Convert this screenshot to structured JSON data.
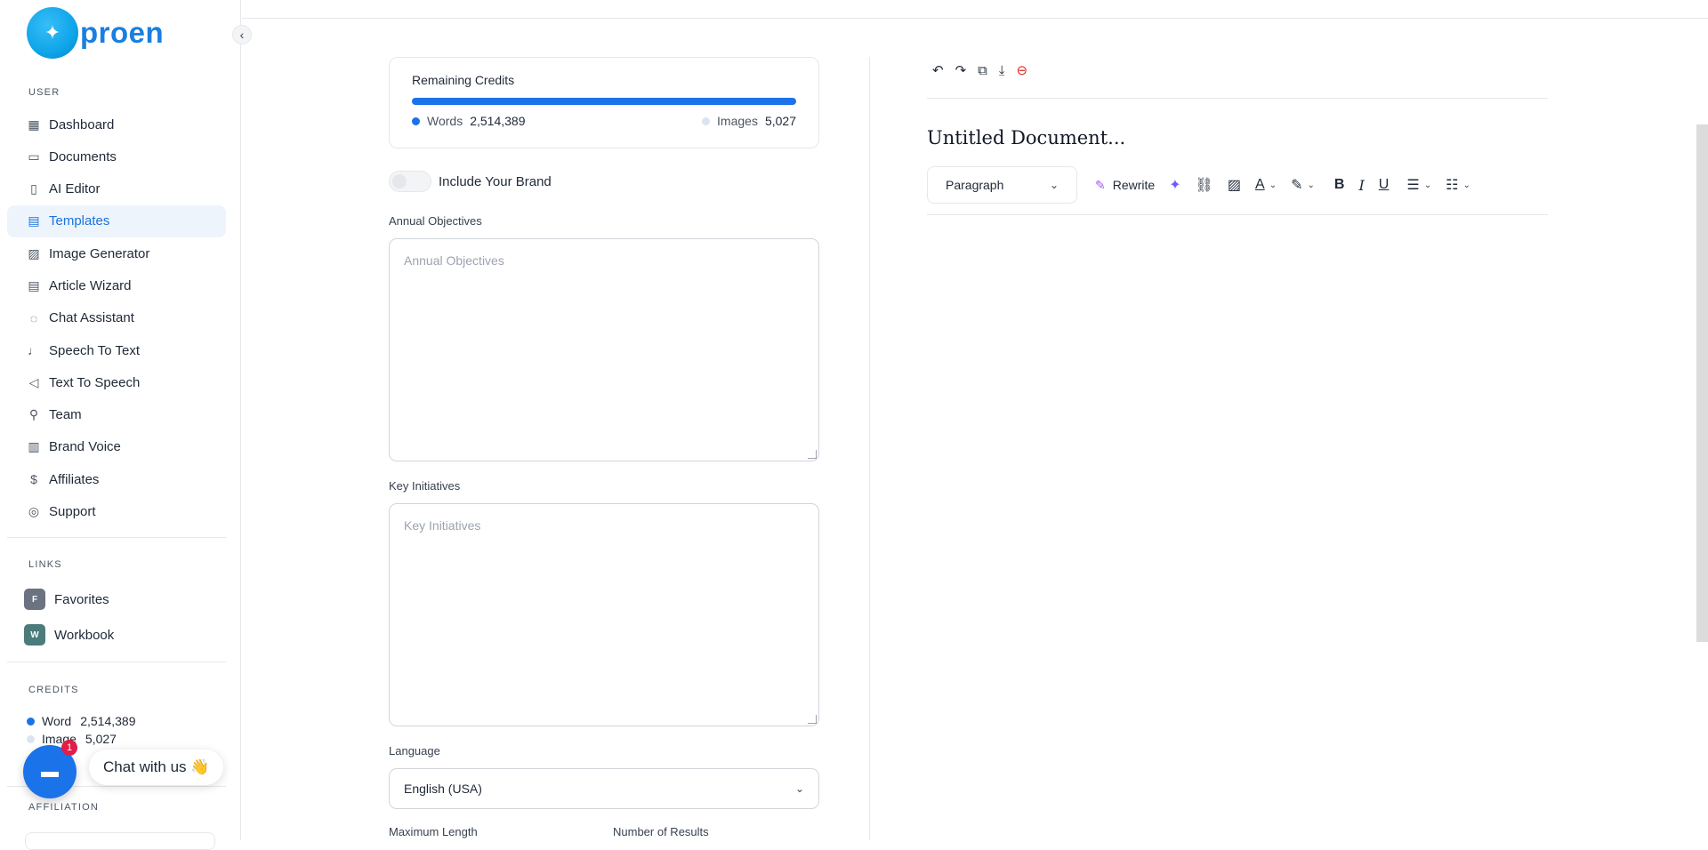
{
  "brand": {
    "name": "proen"
  },
  "sidebar": {
    "user_section": "USER",
    "items": [
      {
        "label": "Dashboard",
        "icon": "grid-icon"
      },
      {
        "label": "Documents",
        "icon": "archive-icon"
      },
      {
        "label": "AI Editor",
        "icon": "book-icon"
      },
      {
        "label": "Templates",
        "icon": "file-text-icon",
        "active": true
      },
      {
        "label": "Image Generator",
        "icon": "image-icon"
      },
      {
        "label": "Article Wizard",
        "icon": "file-edit-icon"
      },
      {
        "label": "Chat Assistant",
        "icon": "chat-bubble-icon"
      },
      {
        "label": "Speech To Text",
        "icon": "microphone-icon"
      },
      {
        "label": "Text To Speech",
        "icon": "speaker-icon"
      },
      {
        "label": "Team",
        "icon": "user-plus-icon"
      },
      {
        "label": "Brand Voice",
        "icon": "layout-icon"
      },
      {
        "label": "Affiliates",
        "icon": "dollar-icon"
      },
      {
        "label": "Support",
        "icon": "lifebuoy-icon"
      }
    ],
    "links_section": "LINKS",
    "links": [
      {
        "badge": "F",
        "label": "Favorites"
      },
      {
        "badge": "W",
        "label": "Workbook"
      }
    ],
    "credits_section": "CREDITS",
    "credits": {
      "word_label": "Word",
      "word_value": "2,514,389",
      "image_label": "Image",
      "image_value": "5,027"
    },
    "affiliation_section": "AFFILIATION"
  },
  "chat": {
    "badge_count": "1",
    "label": "Chat with us 👋"
  },
  "form": {
    "credits_card": {
      "title": "Remaining Credits",
      "progress": 1.0,
      "words_label": "Words",
      "words_value": "2,514,389",
      "images_label": "Images",
      "images_value": "5,027"
    },
    "brand_toggle_label": "Include Your Brand",
    "brand_toggle_on": false,
    "annual_objectives": {
      "label": "Annual Objectives",
      "placeholder": "Annual Objectives"
    },
    "key_initiatives": {
      "label": "Key Initiatives",
      "placeholder": "Key Initiatives"
    },
    "language": {
      "label": "Language",
      "value": "English (USA)"
    },
    "max_length_label": "Maximum Length",
    "num_results_label": "Number of Results"
  },
  "editor": {
    "title": "Untitled Document...",
    "paragraph_select": "Paragraph",
    "rewrite_label": "Rewrite"
  },
  "colors": {
    "accent": "#1a73e8",
    "danger": "#dc2626",
    "brand": "#1a7fe0"
  }
}
